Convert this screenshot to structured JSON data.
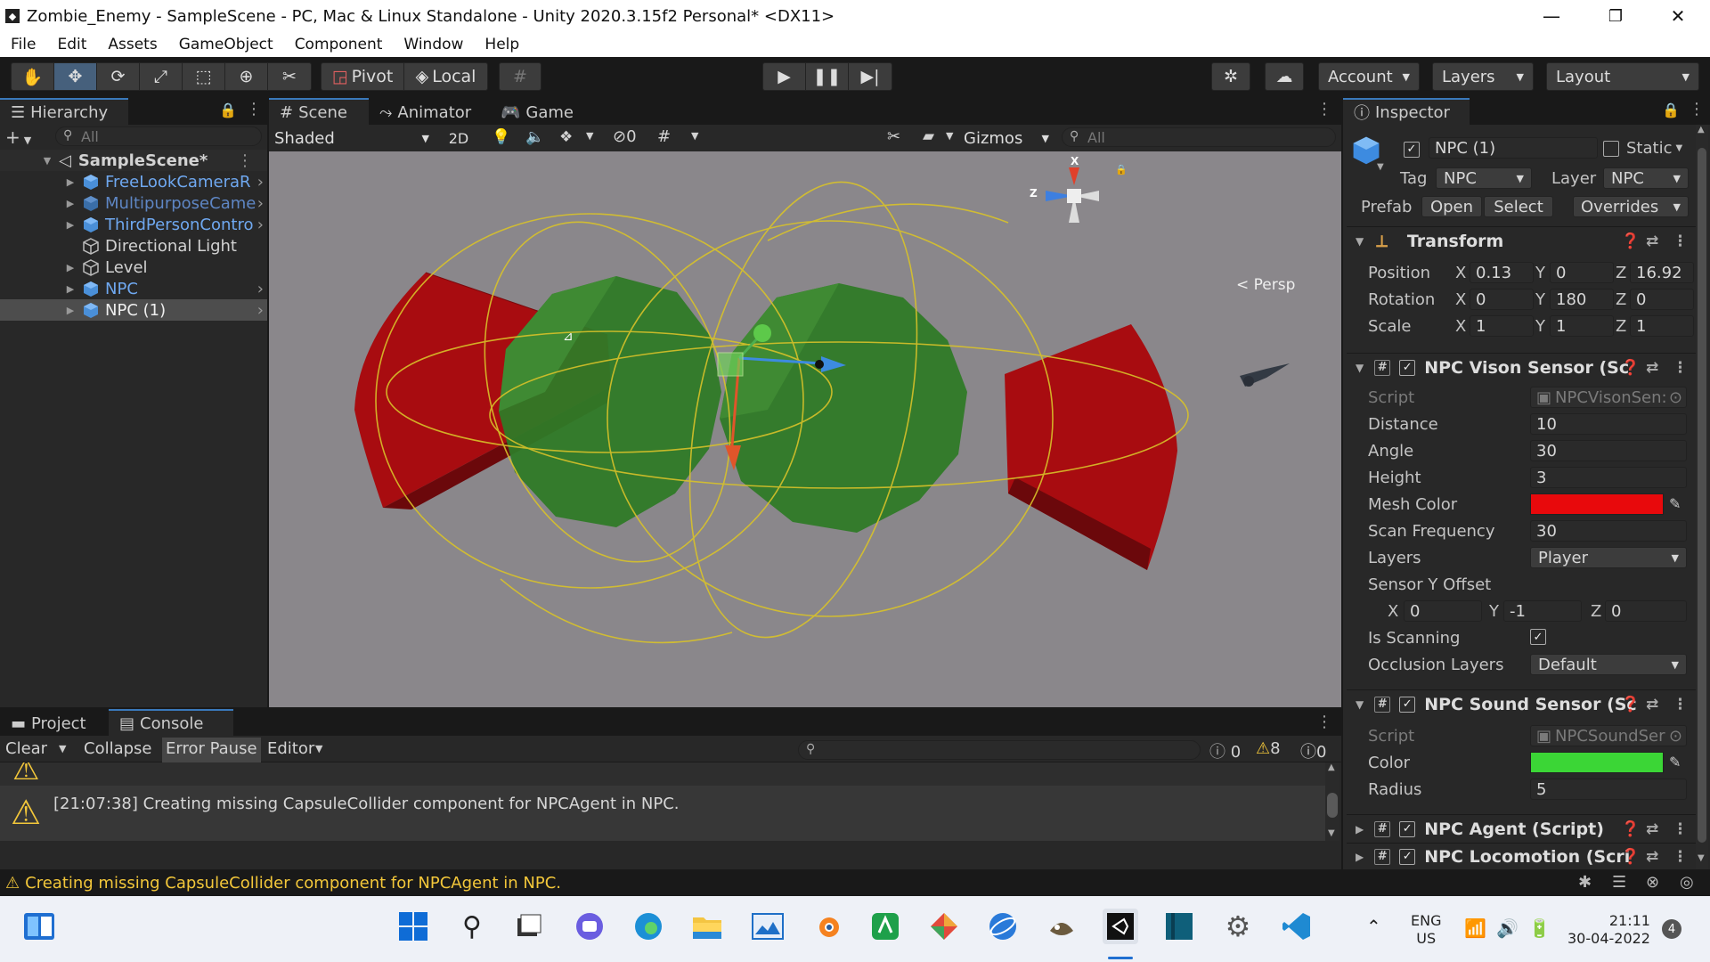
{
  "window": {
    "title": "Zombie_Enemy - SampleScene - PC, Mac & Linux Standalone - Unity 2020.3.15f2 Personal* <DX11>",
    "minimize": "—",
    "maximize": "❐",
    "close": "✕"
  },
  "menu": [
    "File",
    "Edit",
    "Assets",
    "GameObject",
    "Component",
    "Window",
    "Help"
  ],
  "toolbar": {
    "pivot": "Pivot",
    "local": "Local",
    "account": "Account",
    "layers": "Layers",
    "layout": "Layout"
  },
  "hierarchy": {
    "tab": "Hierarchy",
    "search_placeholder": "All",
    "scene": "SampleScene*",
    "items": [
      {
        "label": "FreeLookCameraR",
        "style": "prefab"
      },
      {
        "label": "MultipurposeCame",
        "style": "prefab-dim"
      },
      {
        "label": "ThirdPersonContro",
        "style": "prefab"
      },
      {
        "label": "Directional Light",
        "style": "plain"
      },
      {
        "label": "Level",
        "style": "plain"
      },
      {
        "label": "NPC",
        "style": "prefab"
      },
      {
        "label": "NPC (1)",
        "style": "selected"
      }
    ]
  },
  "scene": {
    "tabs": [
      "Scene",
      "Animator",
      "Game"
    ],
    "shading": "Shaded",
    "mode_2d": "2D",
    "hidden_count": "0",
    "gizmos": "Gizmos",
    "search_placeholder": "All",
    "persp": "Persp",
    "axis_x": "X",
    "axis_z": "Z",
    "colors": {
      "background": "#8a878b",
      "cone": "#a80c10",
      "sphere": "#2e7a26",
      "wire": "#d9c22a"
    }
  },
  "console": {
    "tabs": [
      "Project",
      "Console"
    ],
    "buttons": [
      "Clear",
      "Collapse",
      "Error Pause",
      "Editor"
    ],
    "counts": {
      "log": "0",
      "warn": "8",
      "error": "0"
    },
    "message": "[21:07:38] Creating missing CapsuleCollider component for NPCAgent in NPC."
  },
  "status_message": "Creating missing CapsuleCollider component for NPCAgent in NPC.",
  "inspector": {
    "tab": "Inspector",
    "object_name": "NPC (1)",
    "static_label": "Static",
    "tag_label": "Tag",
    "tag_value": "NPC",
    "layer_label": "Layer",
    "layer_value": "NPC",
    "prefab_label": "Prefab",
    "prefab_open": "Open",
    "prefab_select": "Select",
    "prefab_overrides": "Overrides",
    "transform": {
      "title": "Transform",
      "position": {
        "label": "Position",
        "x": "0.13",
        "y": "0",
        "z": "16.92"
      },
      "rotation": {
        "label": "Rotation",
        "x": "0",
        "y": "180",
        "z": "0"
      },
      "scale": {
        "label": "Scale",
        "x": "1",
        "y": "1",
        "z": "1"
      }
    },
    "vision": {
      "title": "NPC Vison Sensor (Sc",
      "script_label": "Script",
      "script_value": "NPCVisonSen:",
      "distance_label": "Distance",
      "distance": "10",
      "angle_label": "Angle",
      "angle": "30",
      "height_label": "Height",
      "height": "3",
      "mesh_color_label": "Mesh Color",
      "mesh_color": "#e8090c",
      "scan_label": "Scan Frequency",
      "scan": "30",
      "layers_label": "Layers",
      "layers": "Player",
      "offset_label": "Sensor Y Offset",
      "offset_x": "0",
      "offset_y": "-1",
      "offset_z": "0",
      "scanning_label": "Is Scanning",
      "occlusion_label": "Occlusion Layers",
      "occlusion": "Default"
    },
    "sound": {
      "title": "NPC Sound Sensor (Sc",
      "script_label": "Script",
      "script_value": "NPCSoundSer",
      "color_label": "Color",
      "color": "#3bd636",
      "radius_label": "Radius",
      "radius": "5"
    },
    "agent_title": "NPC Agent (Script)",
    "locomotion_title": "NPC Locomotion (Scri"
  },
  "taskbar": {
    "lang": "ENG",
    "region": "US",
    "time": "21:11",
    "date": "30-04-2022",
    "badge": "4"
  }
}
